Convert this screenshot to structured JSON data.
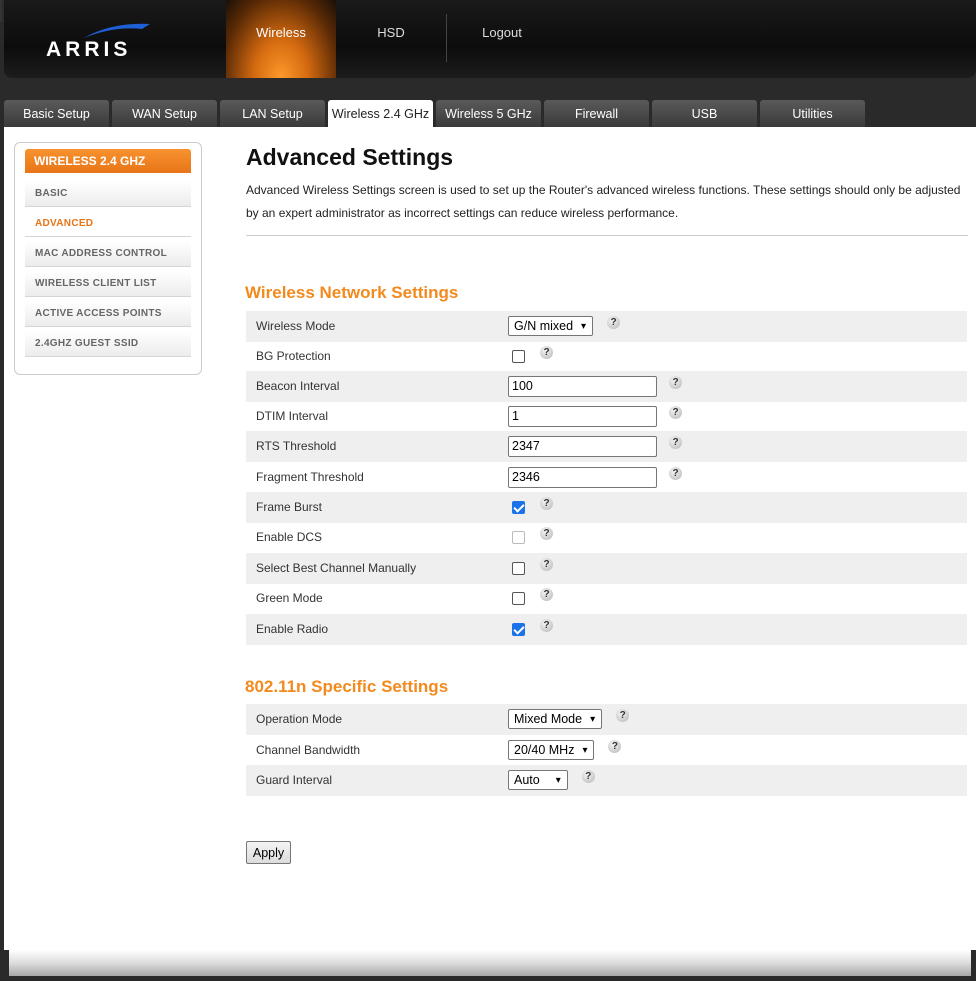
{
  "header": {
    "logo_text": "ARRIS",
    "nav": [
      {
        "label": "Wireless",
        "active": true
      },
      {
        "label": "HSD",
        "active": false
      },
      {
        "label": "Logout",
        "active": false
      }
    ]
  },
  "tabs": [
    {
      "label": "Basic Setup"
    },
    {
      "label": "WAN Setup"
    },
    {
      "label": "LAN Setup"
    },
    {
      "label": "Wireless 2.4 GHz",
      "active": true
    },
    {
      "label": "Wireless 5 GHz"
    },
    {
      "label": "Firewall"
    },
    {
      "label": "USB"
    },
    {
      "label": "Utilities"
    }
  ],
  "sidebar": {
    "title": "WIRELESS 2.4 GHZ",
    "items": [
      {
        "label": "BASIC"
      },
      {
        "label": "ADVANCED",
        "active": true
      },
      {
        "label": "MAC ADDRESS CONTROL"
      },
      {
        "label": "WIRELESS CLIENT LIST"
      },
      {
        "label": "ACTIVE ACCESS POINTS"
      },
      {
        "label": "2.4GHZ GUEST SSID"
      }
    ]
  },
  "main": {
    "title": "Advanced Settings",
    "intro": "Advanced Wireless Settings screen is used to set up the Router's advanced wireless functions. These settings should only be adjusted by an expert administrator as incorrect settings can reduce wireless performance.",
    "wireless_section": {
      "title": "Wireless Network Settings",
      "rows": [
        {
          "label": "Wireless Mode",
          "type": "select",
          "value": "G/N mixed"
        },
        {
          "label": "BG Protection",
          "type": "checkbox",
          "checked": false
        },
        {
          "label": "Beacon Interval",
          "type": "input",
          "value": "100"
        },
        {
          "label": "DTIM Interval",
          "type": "input",
          "value": "1"
        },
        {
          "label": "RTS Threshold",
          "type": "input",
          "value": "2347"
        },
        {
          "label": "Fragment Threshold",
          "type": "input",
          "value": "2346"
        },
        {
          "label": "Frame Burst",
          "type": "checkbox",
          "checked": true
        },
        {
          "label": "Enable DCS",
          "type": "checkbox",
          "checked": false,
          "disabled": true
        },
        {
          "label": "Select Best Channel Manually",
          "type": "checkbox",
          "checked": false
        },
        {
          "label": "Green Mode",
          "type": "checkbox",
          "checked": false
        },
        {
          "label": "Enable Radio",
          "type": "checkbox",
          "checked": true
        }
      ]
    },
    "n_section": {
      "title": "802.11n Specific Settings",
      "rows": [
        {
          "label": "Operation Mode",
          "type": "select",
          "value": "Mixed Mode"
        },
        {
          "label": "Channel Bandwidth",
          "type": "select",
          "value": "20/40 MHz"
        },
        {
          "label": "Guard Interval",
          "type": "select",
          "value": "Auto"
        }
      ]
    },
    "help_glyph": "?",
    "apply_label": "Apply"
  },
  "colors": {
    "accent": "#f28a1e",
    "tab_bg": "#4a4a4a",
    "checkbox_checked": "#1a73e8"
  }
}
